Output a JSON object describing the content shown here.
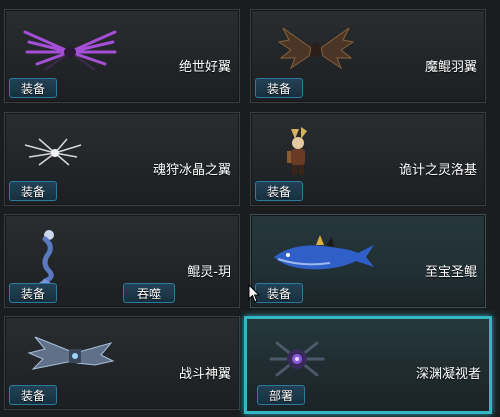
{
  "cards": [
    {
      "name": "绝世好翼",
      "button": "装备",
      "icon": "purple-wings-icon"
    },
    {
      "name": "魔鲲羽翼",
      "button": "装备",
      "icon": "dark-wings-icon"
    },
    {
      "name": "魂狩冰晶之翼",
      "button": "装备",
      "icon": "crystal-wings-icon"
    },
    {
      "name": "诡计之灵洛基",
      "button": "装备",
      "icon": "loki-figure-icon"
    },
    {
      "name": "鲲灵-玥",
      "button": "装备",
      "second_button": "吞噬",
      "icon": "mermaid-figure-icon"
    },
    {
      "name": "至宝圣鲲",
      "button": "装备",
      "icon": "blue-whale-icon"
    },
    {
      "name": "战斗神翼",
      "button": "装备",
      "icon": "mech-wings-icon"
    },
    {
      "name": "深渊凝视者",
      "button": "部署",
      "icon": "abyss-eye-icon"
    }
  ],
  "colors": {
    "selected_border": "#35b5c6",
    "button_border": "#2d7aa0"
  }
}
